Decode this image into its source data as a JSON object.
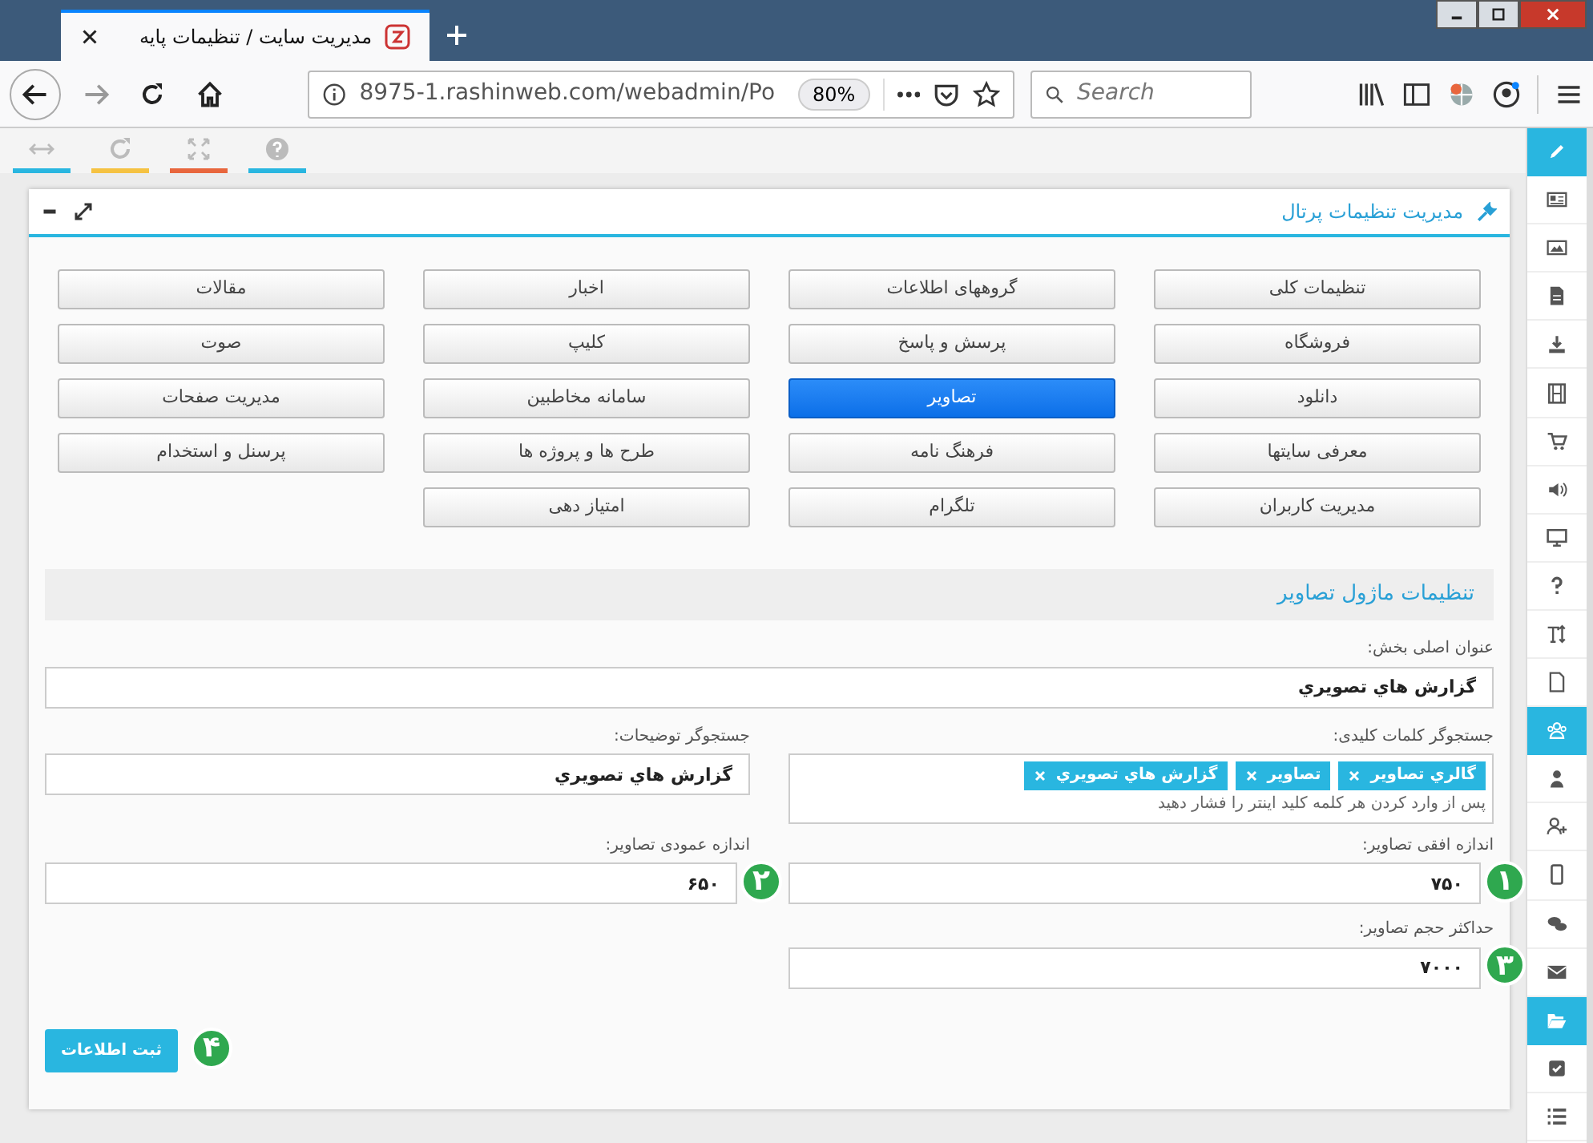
{
  "browser": {
    "tab_title": "مدیریت سایت / تنظیمات پایه",
    "url": "8975-1.rashinweb.com/webadmin/Po",
    "zoom": "80%",
    "search": {
      "placeholder": "Search"
    }
  },
  "toolbar": [
    {
      "color": "#29b6e0"
    },
    {
      "color": "#f5c242"
    },
    {
      "color": "#e8663d"
    },
    {
      "color": "#29b6e0"
    }
  ],
  "panel": {
    "title": "مدیریت تنظیمات پرتال",
    "modules": [
      {
        "label": "تنظیمات کلی",
        "selected": false
      },
      {
        "label": "گروههای اطلاعات",
        "selected": false
      },
      {
        "label": "اخبار",
        "selected": false
      },
      {
        "label": "مقالات",
        "selected": false
      },
      {
        "label": "فروشگاه",
        "selected": false
      },
      {
        "label": "پرسش و پاسخ",
        "selected": false
      },
      {
        "label": "کلیپ",
        "selected": false
      },
      {
        "label": "صوت",
        "selected": false
      },
      {
        "label": "دانلود",
        "selected": false
      },
      {
        "label": "تصاویر",
        "selected": true
      },
      {
        "label": "سامانه مخاطبین",
        "selected": false
      },
      {
        "label": "مدیریت صفحات",
        "selected": false
      },
      {
        "label": "معرفی سایتها",
        "selected": false
      },
      {
        "label": "فرهنگ نامه",
        "selected": false
      },
      {
        "label": "طرح ها و پروژه ها",
        "selected": false
      },
      {
        "label": "پرسنل و استخدام",
        "selected": false
      },
      {
        "label": "مدیریت کاربران",
        "selected": false
      },
      {
        "label": "تلگرام",
        "selected": false
      },
      {
        "label": "امتیاز دهی",
        "selected": false
      }
    ],
    "section_title": "تنظیمات ماژول تصاویر",
    "main_title": {
      "label": "عنوان اصلی بخش:",
      "value": "گزارش هاي تصويري"
    },
    "keywords": {
      "label": "جستجوگر کلمات کلیدی:",
      "tags": [
        "گالري تصاوير",
        "تصاوير",
        "گزارش هاي تصويري"
      ],
      "hint": "پس از وارد کردن هر کلمه کلید اینتر را فشار دهید"
    },
    "description_search": {
      "label": "جستجوگر توضیحات:",
      "value": "گزارش هاي تصويري"
    },
    "width": {
      "label": "اندازه افقی تصاویر:",
      "value": "۷۵۰",
      "marker": "۱"
    },
    "height": {
      "label": "اندازه عمودی تصاویر:",
      "value": "۶۵۰",
      "marker": "۲"
    },
    "max_size": {
      "label": "حداکثر حجم تصاویر:",
      "value": "۷۰۰۰",
      "marker": "۳"
    },
    "submit": {
      "label": "ثبت اطلاعات",
      "marker": "۴"
    }
  },
  "sidebar": [
    {
      "selected": true
    },
    {
      "selected": false
    },
    {
      "selected": false
    },
    {
      "selected": false
    },
    {
      "selected": false
    },
    {
      "selected": false
    },
    {
      "selected": false
    },
    {
      "selected": false
    },
    {
      "selected": false
    },
    {
      "selected": false
    },
    {
      "selected": false
    },
    {
      "selected": false
    },
    {
      "selected": true
    },
    {
      "selected": false
    },
    {
      "selected": false
    },
    {
      "selected": false
    },
    {
      "selected": false
    },
    {
      "selected": false
    },
    {
      "selected": true
    },
    {
      "selected": false
    },
    {
      "selected": false
    }
  ]
}
